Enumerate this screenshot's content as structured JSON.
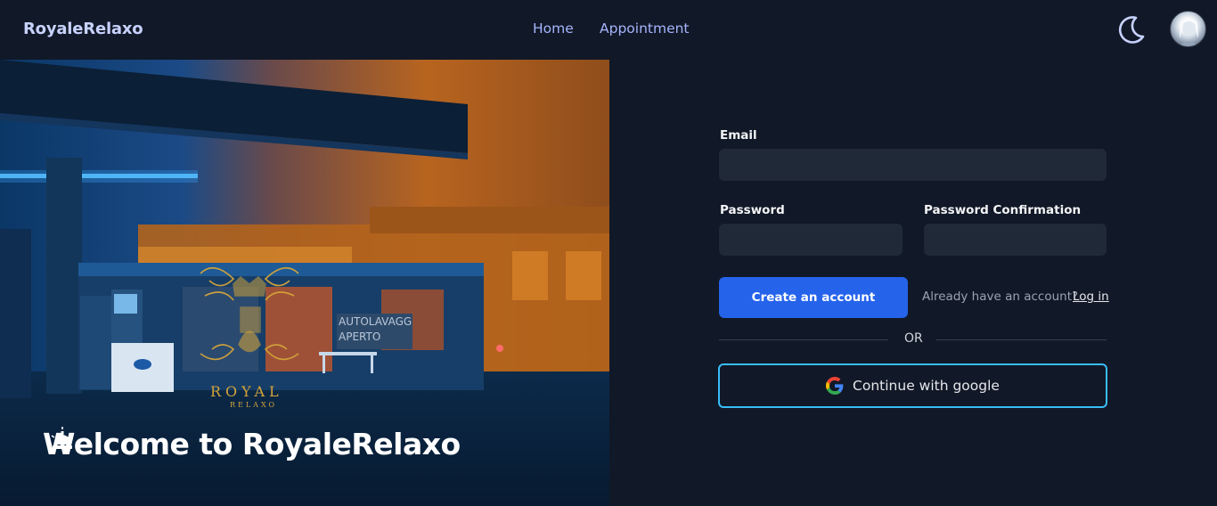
{
  "navbar": {
    "brand": "RoyaleRelaxo",
    "links": [
      {
        "label": "Home"
      },
      {
        "label": "Appointment"
      }
    ],
    "theme_icon": "moon-icon",
    "avatar_icon": "user-avatar"
  },
  "hero": {
    "welcome": "Welcome to RoyaleRelaxo",
    "emoji_icon": "bellhop-bell-icon",
    "logo_text_top": "ROYAL",
    "logo_text_bottom": "RELAXO",
    "sign_text_1": "AUTOLAVAGG",
    "sign_text_2": "APERTO"
  },
  "form": {
    "email_label": "Email",
    "email_value": "",
    "password_label": "Password",
    "password_value": "",
    "password_confirm_label": "Password Confirmation",
    "password_confirm_value": "",
    "create_button": "Create an account",
    "already_text": "Already have an account?",
    "login_link": "Log in",
    "or_text": "OR",
    "google_button": "Continue with google",
    "google_icon": "google-icon"
  },
  "colors": {
    "background": "#111827",
    "input_bg": "#1f2937",
    "primary": "#2563eb",
    "google_border": "#38bdf8",
    "nav_link": "#a5b4fc"
  }
}
